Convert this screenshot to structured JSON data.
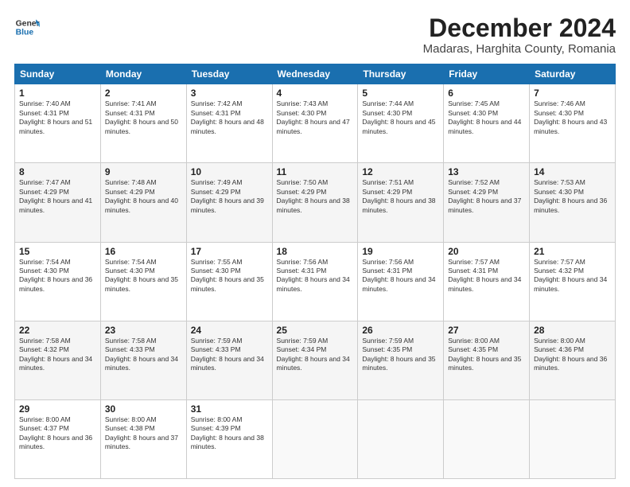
{
  "header": {
    "logo_line1": "General",
    "logo_line2": "Blue",
    "title": "December 2024",
    "subtitle": "Madaras, Harghita County, Romania"
  },
  "weekdays": [
    "Sunday",
    "Monday",
    "Tuesday",
    "Wednesday",
    "Thursday",
    "Friday",
    "Saturday"
  ],
  "weeks": [
    [
      {
        "day": "1",
        "sunrise": "Sunrise: 7:40 AM",
        "sunset": "Sunset: 4:31 PM",
        "daylight": "Daylight: 8 hours and 51 minutes."
      },
      {
        "day": "2",
        "sunrise": "Sunrise: 7:41 AM",
        "sunset": "Sunset: 4:31 PM",
        "daylight": "Daylight: 8 hours and 50 minutes."
      },
      {
        "day": "3",
        "sunrise": "Sunrise: 7:42 AM",
        "sunset": "Sunset: 4:31 PM",
        "daylight": "Daylight: 8 hours and 48 minutes."
      },
      {
        "day": "4",
        "sunrise": "Sunrise: 7:43 AM",
        "sunset": "Sunset: 4:30 PM",
        "daylight": "Daylight: 8 hours and 47 minutes."
      },
      {
        "day": "5",
        "sunrise": "Sunrise: 7:44 AM",
        "sunset": "Sunset: 4:30 PM",
        "daylight": "Daylight: 8 hours and 45 minutes."
      },
      {
        "day": "6",
        "sunrise": "Sunrise: 7:45 AM",
        "sunset": "Sunset: 4:30 PM",
        "daylight": "Daylight: 8 hours and 44 minutes."
      },
      {
        "day": "7",
        "sunrise": "Sunrise: 7:46 AM",
        "sunset": "Sunset: 4:30 PM",
        "daylight": "Daylight: 8 hours and 43 minutes."
      }
    ],
    [
      {
        "day": "8",
        "sunrise": "Sunrise: 7:47 AM",
        "sunset": "Sunset: 4:29 PM",
        "daylight": "Daylight: 8 hours and 41 minutes."
      },
      {
        "day": "9",
        "sunrise": "Sunrise: 7:48 AM",
        "sunset": "Sunset: 4:29 PM",
        "daylight": "Daylight: 8 hours and 40 minutes."
      },
      {
        "day": "10",
        "sunrise": "Sunrise: 7:49 AM",
        "sunset": "Sunset: 4:29 PM",
        "daylight": "Daylight: 8 hours and 39 minutes."
      },
      {
        "day": "11",
        "sunrise": "Sunrise: 7:50 AM",
        "sunset": "Sunset: 4:29 PM",
        "daylight": "Daylight: 8 hours and 38 minutes."
      },
      {
        "day": "12",
        "sunrise": "Sunrise: 7:51 AM",
        "sunset": "Sunset: 4:29 PM",
        "daylight": "Daylight: 8 hours and 38 minutes."
      },
      {
        "day": "13",
        "sunrise": "Sunrise: 7:52 AM",
        "sunset": "Sunset: 4:29 PM",
        "daylight": "Daylight: 8 hours and 37 minutes."
      },
      {
        "day": "14",
        "sunrise": "Sunrise: 7:53 AM",
        "sunset": "Sunset: 4:30 PM",
        "daylight": "Daylight: 8 hours and 36 minutes."
      }
    ],
    [
      {
        "day": "15",
        "sunrise": "Sunrise: 7:54 AM",
        "sunset": "Sunset: 4:30 PM",
        "daylight": "Daylight: 8 hours and 36 minutes."
      },
      {
        "day": "16",
        "sunrise": "Sunrise: 7:54 AM",
        "sunset": "Sunset: 4:30 PM",
        "daylight": "Daylight: 8 hours and 35 minutes."
      },
      {
        "day": "17",
        "sunrise": "Sunrise: 7:55 AM",
        "sunset": "Sunset: 4:30 PM",
        "daylight": "Daylight: 8 hours and 35 minutes."
      },
      {
        "day": "18",
        "sunrise": "Sunrise: 7:56 AM",
        "sunset": "Sunset: 4:31 PM",
        "daylight": "Daylight: 8 hours and 34 minutes."
      },
      {
        "day": "19",
        "sunrise": "Sunrise: 7:56 AM",
        "sunset": "Sunset: 4:31 PM",
        "daylight": "Daylight: 8 hours and 34 minutes."
      },
      {
        "day": "20",
        "sunrise": "Sunrise: 7:57 AM",
        "sunset": "Sunset: 4:31 PM",
        "daylight": "Daylight: 8 hours and 34 minutes."
      },
      {
        "day": "21",
        "sunrise": "Sunrise: 7:57 AM",
        "sunset": "Sunset: 4:32 PM",
        "daylight": "Daylight: 8 hours and 34 minutes."
      }
    ],
    [
      {
        "day": "22",
        "sunrise": "Sunrise: 7:58 AM",
        "sunset": "Sunset: 4:32 PM",
        "daylight": "Daylight: 8 hours and 34 minutes."
      },
      {
        "day": "23",
        "sunrise": "Sunrise: 7:58 AM",
        "sunset": "Sunset: 4:33 PM",
        "daylight": "Daylight: 8 hours and 34 minutes."
      },
      {
        "day": "24",
        "sunrise": "Sunrise: 7:59 AM",
        "sunset": "Sunset: 4:33 PM",
        "daylight": "Daylight: 8 hours and 34 minutes."
      },
      {
        "day": "25",
        "sunrise": "Sunrise: 7:59 AM",
        "sunset": "Sunset: 4:34 PM",
        "daylight": "Daylight: 8 hours and 34 minutes."
      },
      {
        "day": "26",
        "sunrise": "Sunrise: 7:59 AM",
        "sunset": "Sunset: 4:35 PM",
        "daylight": "Daylight: 8 hours and 35 minutes."
      },
      {
        "day": "27",
        "sunrise": "Sunrise: 8:00 AM",
        "sunset": "Sunset: 4:35 PM",
        "daylight": "Daylight: 8 hours and 35 minutes."
      },
      {
        "day": "28",
        "sunrise": "Sunrise: 8:00 AM",
        "sunset": "Sunset: 4:36 PM",
        "daylight": "Daylight: 8 hours and 36 minutes."
      }
    ],
    [
      {
        "day": "29",
        "sunrise": "Sunrise: 8:00 AM",
        "sunset": "Sunset: 4:37 PM",
        "daylight": "Daylight: 8 hours and 36 minutes."
      },
      {
        "day": "30",
        "sunrise": "Sunrise: 8:00 AM",
        "sunset": "Sunset: 4:38 PM",
        "daylight": "Daylight: 8 hours and 37 minutes."
      },
      {
        "day": "31",
        "sunrise": "Sunrise: 8:00 AM",
        "sunset": "Sunset: 4:39 PM",
        "daylight": "Daylight: 8 hours and 38 minutes."
      },
      null,
      null,
      null,
      null
    ]
  ]
}
